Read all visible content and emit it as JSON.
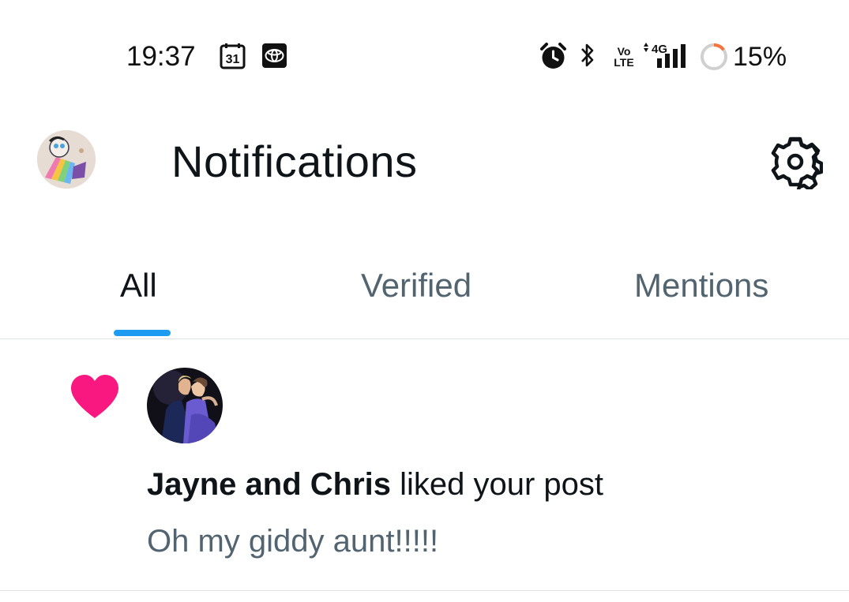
{
  "status_bar": {
    "time": "19:37",
    "calendar_day": "31",
    "network_type": "4G",
    "volte_top": "Vo",
    "volte_bottom": "LTE",
    "battery_percent": "15%",
    "icons": [
      "calendar-icon",
      "toyota-icon",
      "alarm-icon",
      "bluetooth-icon",
      "volte-icon",
      "signal-icon",
      "battery-icon"
    ],
    "battery_level": 0.15
  },
  "header": {
    "title": "Notifications",
    "settings_icon": "gear-icon"
  },
  "tabs": [
    {
      "label": "All",
      "active": true
    },
    {
      "label": "Verified",
      "active": false
    },
    {
      "label": "Mentions",
      "active": false
    }
  ],
  "notifications": [
    {
      "type": "like",
      "icon": "heart-icon",
      "user_name": "Jayne and Chris",
      "action_text": " liked your post",
      "post_snippet": "Oh my giddy aunt!!!!!"
    }
  ],
  "colors": {
    "accent": "#1d9bf0",
    "like": "#f91880",
    "text_primary": "#0f1419",
    "text_secondary": "#536471",
    "battery_warning": "#f4743b"
  }
}
